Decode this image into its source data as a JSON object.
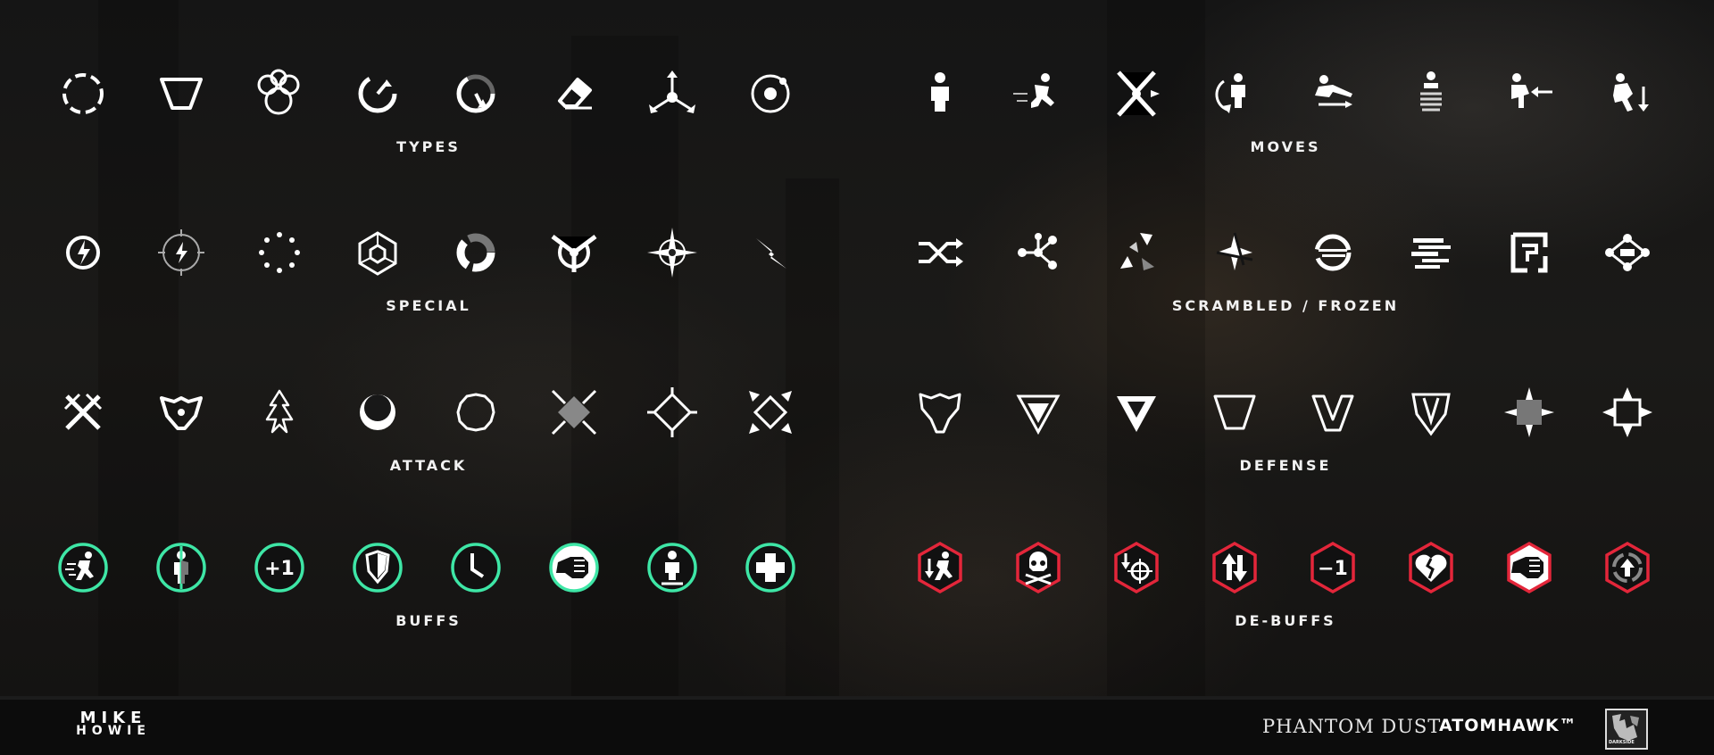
{
  "sections": [
    {
      "id": "types",
      "label": "TYPES",
      "icons": [
        "dashed-circle-icon",
        "inverted-trapezoid-icon",
        "bubble-cluster-icon",
        "clockwise-gauge-icon",
        "counterclockwise-gauge-icon",
        "eraser-icon",
        "tri-arrow-icon",
        "orbit-icon"
      ]
    },
    {
      "id": "moves",
      "label": "MOVES",
      "icons": [
        "standing-figure-icon",
        "dash-figure-icon",
        "x-jump-figure-icon",
        "spin-figure-icon",
        "slide-figure-icon",
        "phase-figure-icon",
        "knockback-figure-icon",
        "fall-figure-icon"
      ]
    },
    {
      "id": "special",
      "label": "SPECIAL",
      "icons": [
        "lightning-disc-icon",
        "lightning-crosshair-icon",
        "dotted-ring-icon",
        "hex-cube-icon",
        "segmented-ring-icon",
        "tri-blade-icon",
        "four-point-star-icon",
        "lightning-bolt-icon"
      ]
    },
    {
      "id": "scrambled",
      "label": "SCRAMBLED / FROZEN",
      "icons": [
        "shuffle-icon",
        "node-network-icon",
        "shard-burst-icon",
        "shattered-star-icon",
        "glitch-cycle-icon",
        "glitch-lines-icon",
        "broken-frame-icon",
        "scrambled-network-icon"
      ]
    },
    {
      "id": "attack",
      "label": "ATTACK",
      "icons": [
        "crossed-swords-icon",
        "horned-skull-icon",
        "arrowhead-tree-icon",
        "crescent-icon",
        "rough-circle-icon",
        "diamond-spikes-icon",
        "diamond-cross-icon",
        "spiked-frame-icon"
      ]
    },
    {
      "id": "defense",
      "label": "DEFENSE",
      "icons": [
        "thorned-shield-icon",
        "down-triangle-badge-icon",
        "down-triangle-icon",
        "trapezoid-outline-icon",
        "v-shield-icon",
        "pointed-shield-icon",
        "spiked-square-icon",
        "spiked-frame-shield-icon"
      ]
    },
    {
      "id": "buffs",
      "label": "BUFFS",
      "accent": "#3ee6a6",
      "icons": [
        "running-figure-icon",
        "split-figure-icon",
        "plus-one-icon",
        "shield-icon",
        "clock-icon",
        "fist-hand-icon",
        "raised-figure-icon",
        "plus-cross-icon"
      ],
      "texts": {
        "2": "+1"
      }
    },
    {
      "id": "debuffs",
      "label": "DE-BUFFS",
      "accent": "#e3263a",
      "icons": [
        "slowed-runner-icon",
        "skull-crossbones-icon",
        "down-target-icon",
        "up-down-arrows-icon",
        "minus-one-icon",
        "broken-heart-icon",
        "fist-hand-icon",
        "up-arrow-cycle-icon"
      ],
      "texts": {
        "4": "−1"
      }
    }
  ],
  "footer": {
    "artist_line1": "MIKE",
    "artist_line2": "HOWIE",
    "game_title": "PHANTOM DUST",
    "studio": "ATOMHAWK™",
    "publisher_logo": "DARKSIDE"
  }
}
